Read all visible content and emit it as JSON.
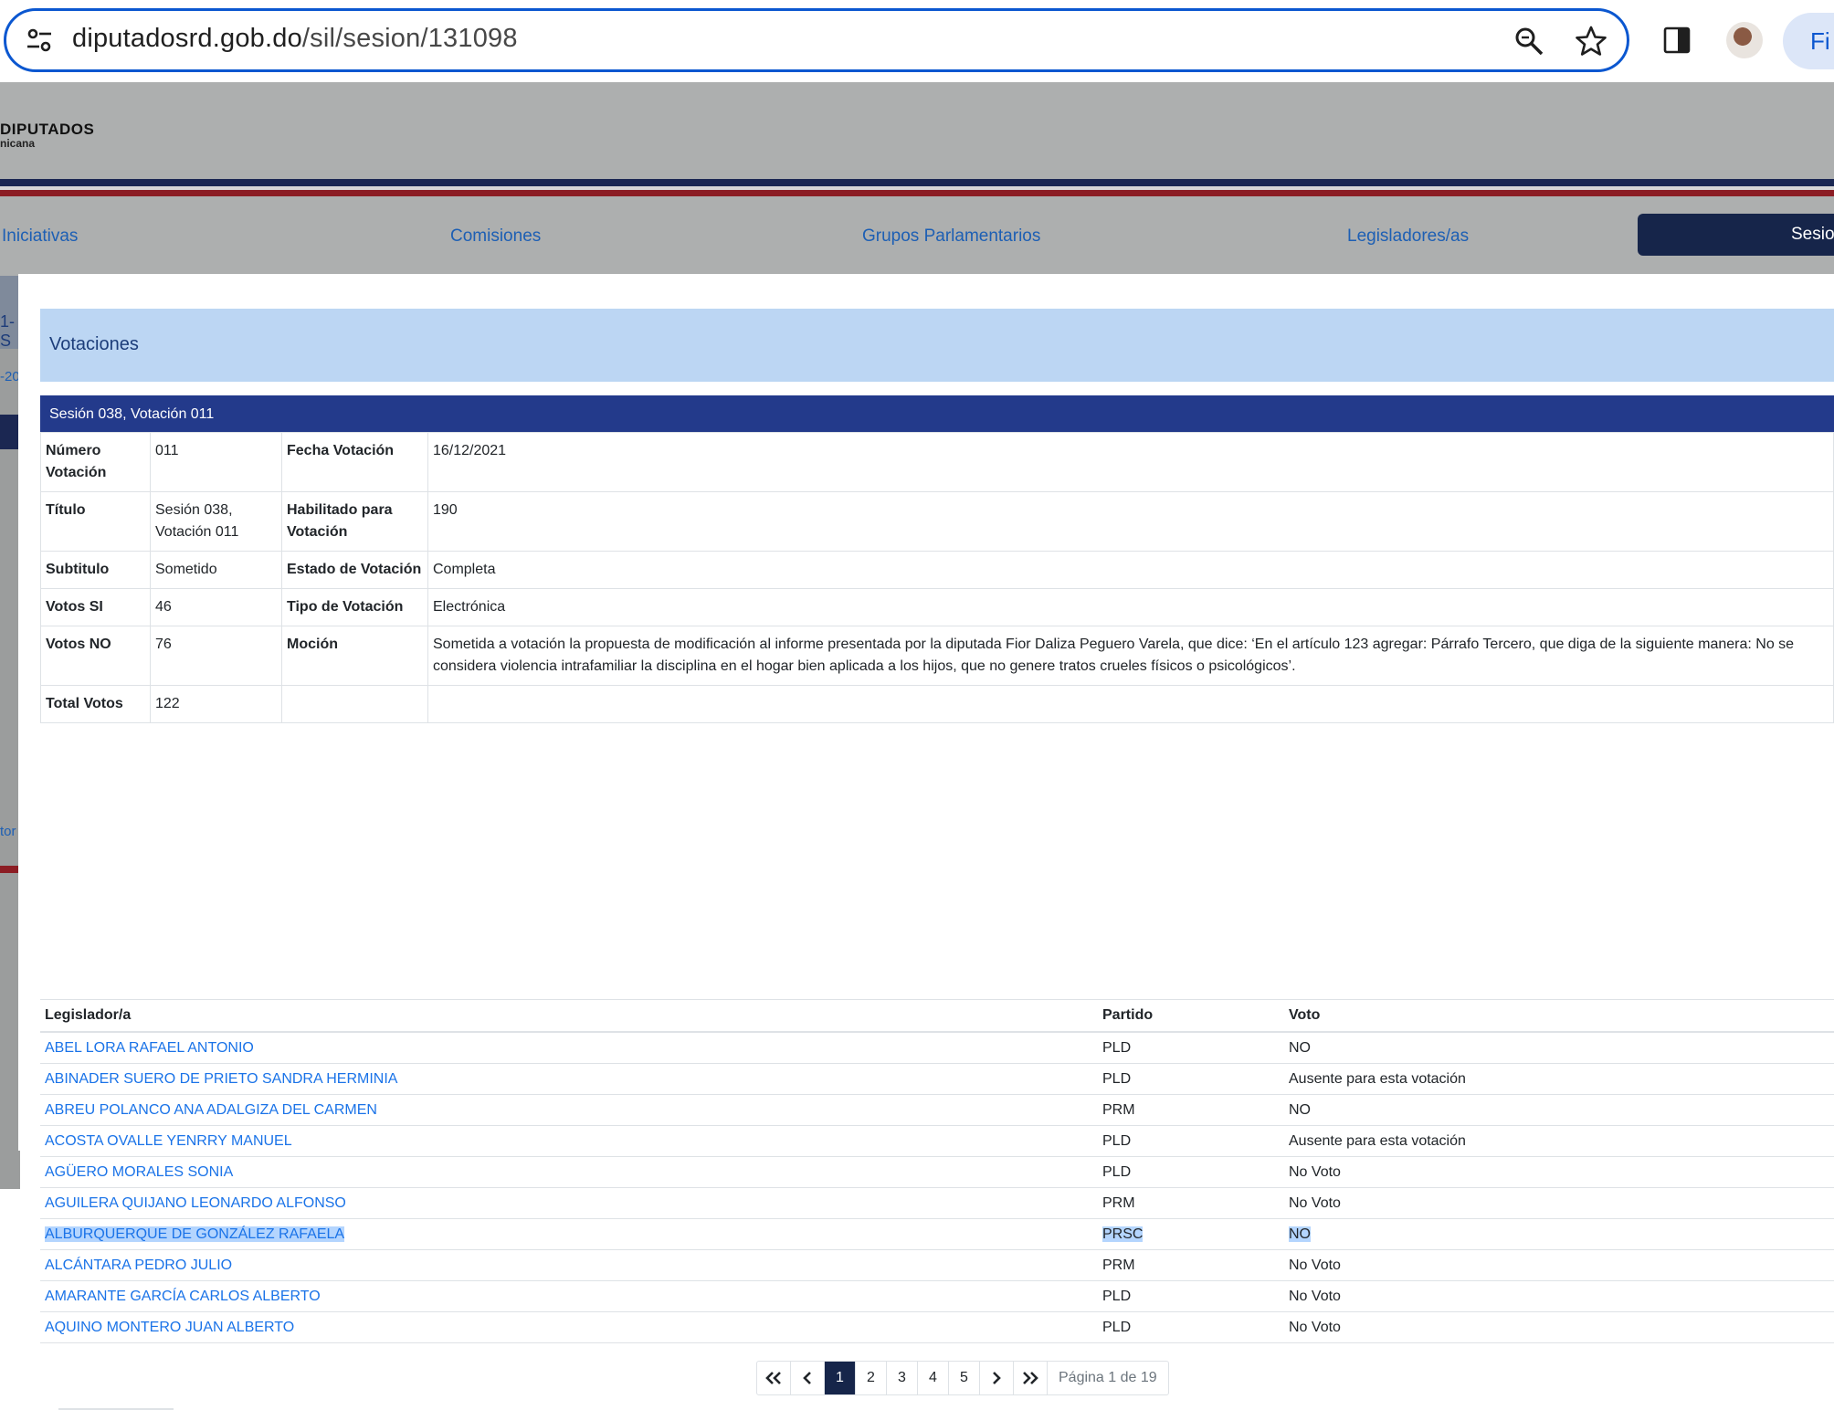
{
  "browser": {
    "url_host": "diputadosrd.gob.do",
    "url_path": "/sil/sesion/131098",
    "finish_label": "Fi"
  },
  "site": {
    "brand": "DIPUTADOS",
    "brand_sub": "nicana",
    "nav": [
      "Iniciativas",
      "Comisiones",
      "Grupos Parlamentarios",
      "Legisladores/as"
    ],
    "nav_active": "Sesio",
    "side_peek": [
      "1-S",
      "-20",
      "tor"
    ]
  },
  "modal": {
    "title": "Votaciones",
    "close": "×",
    "detail_title": "Sesión 038, Votación 011",
    "info": [
      {
        "k1": "Número Votación",
        "v1": "011",
        "k2": "Fecha Votación",
        "v2": "16/12/2021"
      },
      {
        "k1": "Título",
        "v1": "Sesión 038, Votación 011",
        "k2": "Habilitado para Votación",
        "v2": "190"
      },
      {
        "k1": "Subtitulo",
        "v1": "Sometido",
        "k2": "Estado de Votación",
        "v2": "Completa"
      },
      {
        "k1": "Votos SI",
        "v1": "46",
        "k2": "Tipo de Votación",
        "v2": "Electrónica"
      },
      {
        "k1": "Votos NO",
        "v1": "76",
        "k2": "Moción",
        "v2": "Sometida a votación la propuesta de modificación al informe presentada por la diputada Fior Daliza Peguero Varela, que dice: ‘En el artículo 123 agregar: Párrafo Tercero, que diga de la siguiente manera: No se considera violencia intrafamiliar la disciplina en el hogar bien aplicada a los hijos, que no genere tratos crueles físicos o psicológicos’."
      },
      {
        "k1": "Total Votos",
        "v1": "122",
        "k2": "",
        "v2": ""
      }
    ],
    "columns": [
      "Legislador/a",
      "Partido",
      "Voto"
    ],
    "rows": [
      {
        "name": "ABEL LORA RAFAEL ANTONIO",
        "party": "PLD",
        "vote": "NO"
      },
      {
        "name": "ABINADER SUERO DE PRIETO SANDRA HERMINIA",
        "party": "PLD",
        "vote": "Ausente para esta votación"
      },
      {
        "name": "ABREU POLANCO ANA ADALGIZA DEL CARMEN",
        "party": "PRM",
        "vote": "NO"
      },
      {
        "name": "ACOSTA OVALLE YENRRY MANUEL",
        "party": "PLD",
        "vote": "Ausente para esta votación"
      },
      {
        "name": "AGÜERO MORALES SONIA",
        "party": "PLD",
        "vote": "No Voto"
      },
      {
        "name": "AGUILERA QUIJANO LEONARDO ALFONSO",
        "party": "PRM",
        "vote": "No Voto"
      },
      {
        "name": "ALBURQUERQUE DE GONZÁLEZ RAFAELA",
        "party": "PRSC",
        "vote": "NO"
      },
      {
        "name": "ALCÁNTARA PEDRO JULIO",
        "party": "PRM",
        "vote": "No Voto"
      },
      {
        "name": "AMARANTE GARCÍA CARLOS ALBERTO",
        "party": "PLD",
        "vote": "No Voto"
      },
      {
        "name": "AQUINO MONTERO JUAN ALBERTO",
        "party": "PLD",
        "vote": "No Voto"
      }
    ],
    "pagination": {
      "pages": [
        "1",
        "2",
        "3",
        "4",
        "5"
      ],
      "current": "1",
      "info": "Página 1 de 19"
    }
  },
  "colors": {
    "accent": "#233a8b",
    "nav_active": "#16254a",
    "link": "#1a73e8",
    "header_bg": "#bcd6f3",
    "selection": "#b4d5fe"
  }
}
